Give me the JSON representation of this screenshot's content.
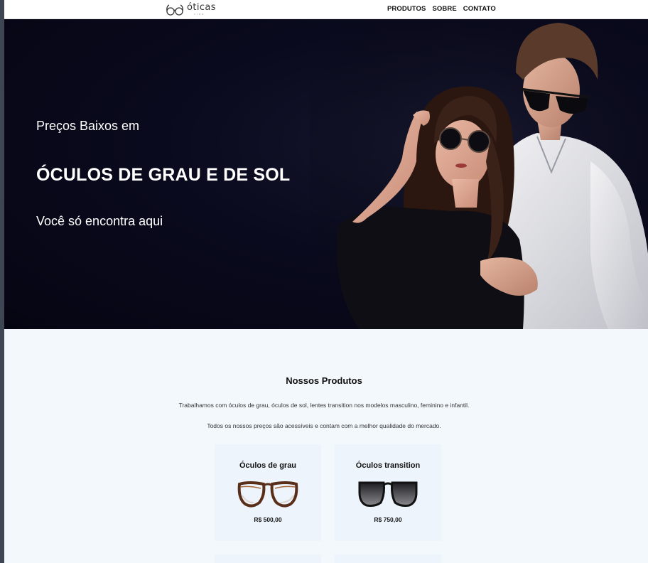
{
  "header": {
    "logo_name": "óticas",
    "logo_sub": "vida",
    "nav": [
      "PRODUTOS",
      "SOBRE",
      "CONTATO"
    ]
  },
  "hero": {
    "pre_title": "Preços Baixos em",
    "title": "ÓCULOS DE GRAU E DE SOL",
    "subtitle": "Você só encontra aqui"
  },
  "products": {
    "title": "Nossos Produtos",
    "desc1": "Trabalhamos com óculos de grau, óculos de sol, lentes transition nos modelos masculino, feminino e infantil.",
    "desc2": "Todos os nossos preços são acessíveis e contam com a melhor qualidade do mercado.",
    "items": [
      {
        "name": "Óculos de grau",
        "price": "R$ 500,00",
        "icon": "tortoise-glasses-icon"
      },
      {
        "name": "Óculos transition",
        "price": "R$ 750,00",
        "icon": "dark-glasses-icon"
      }
    ]
  },
  "colors": {
    "hero_bg": "#0a0a1e",
    "section_bg": "#f3f8fd",
    "card_bg": "#edf4fc"
  }
}
